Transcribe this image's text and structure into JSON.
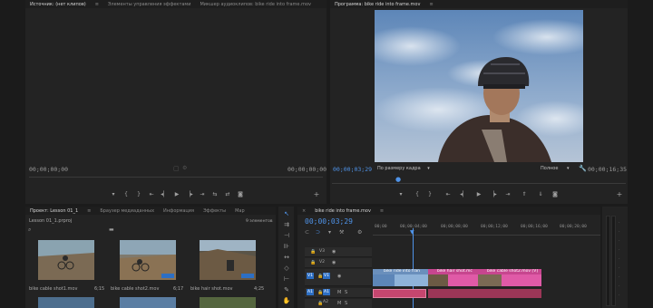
{
  "source_panel": {
    "tabs": [
      "Источник: (нет клипов)",
      "Элементы управления эффектами",
      "Микшер аудиоклипов: bike ride into frame.mov"
    ],
    "timecode_left": "00;00;00;00",
    "timecode_right": "00;00;00;00"
  },
  "program_panel": {
    "tab": "Программа: bike ride into frame.mov",
    "timecode": "00;00;03;29",
    "fit_label": "По размеру кадра",
    "quality_label": "Полное",
    "duration": "00;00;16;35"
  },
  "project_panel": {
    "tabs": [
      "Проект: Lesson 01_1",
      "Браузер медиаданных",
      "Информация",
      "Эффекты",
      "Мар"
    ],
    "file_name": "Lesson 01_1.prproj",
    "item_count": "9 элементов",
    "items": [
      {
        "name": "bike cable shot1.mov",
        "duration": "6;15"
      },
      {
        "name": "bike cable shot2.mov",
        "duration": "6;17"
      },
      {
        "name": "bike hair shot.mov",
        "duration": "4;25"
      }
    ]
  },
  "timeline": {
    "tab": "bike ride into frame.mov",
    "timecode": "00;00;03;29",
    "ruler_labels": [
      "00;00",
      "00;00;04;00",
      "00;00;08;00",
      "00;00;12;00",
      "00;00;16;00",
      "00;00;20;00"
    ],
    "tracks": [
      {
        "label": "V3"
      },
      {
        "label": "V2"
      },
      {
        "label": "V1",
        "source": "V1"
      },
      {
        "label": "A1",
        "source": "A1"
      },
      {
        "label": "A2"
      }
    ],
    "clips": {
      "v1_a": "bike ride into fran",
      "v1_b": "bike hair shot.mc",
      "v1_c": "bike cable shot2.mov [V]"
    }
  },
  "colors": {
    "accent_blue": "#4f93e8",
    "clip_blue": "#8fb3d9",
    "clip_pink": "#e05aa7",
    "audio_clip": "#c5466f"
  }
}
